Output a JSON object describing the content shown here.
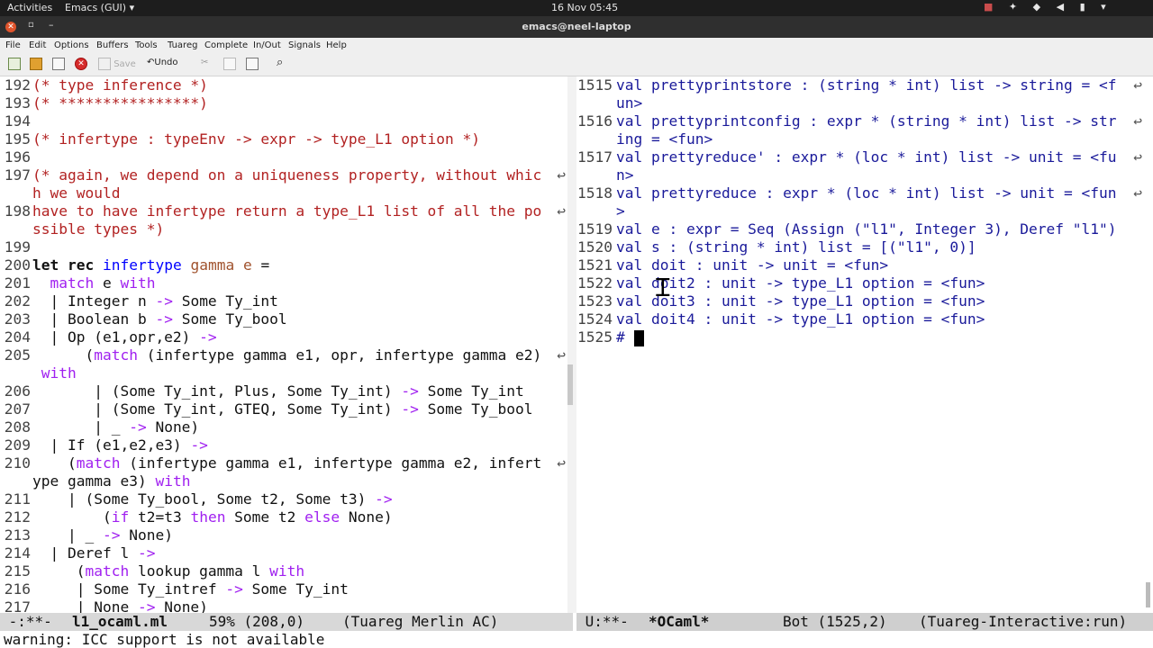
{
  "topbar": {
    "activities": "Activities",
    "app_menu": "Emacs (GUI) ▾",
    "clock": "16 Nov  05:45",
    "tray_icons": [
      "record-icon",
      "accessibility-icon",
      "wifi-icon",
      "volume-icon",
      "battery-icon",
      "menu-arrow-icon"
    ]
  },
  "window": {
    "title": "emacs@neel-laptop"
  },
  "menubar": {
    "items": [
      "File",
      "Edit",
      "Options",
      "Buffers",
      "Tools",
      "Tuareg",
      "Complete",
      "In/Out",
      "Signals",
      "Help"
    ]
  },
  "toolbar": {
    "save_label": "Save",
    "undo_label": "Undo"
  },
  "left_pane": {
    "lines": [
      {
        "n": "192",
        "t": "(* type inference *)"
      },
      {
        "n": "193",
        "t": "(* ****************)"
      },
      {
        "n": "194",
        "t": ""
      },
      {
        "n": "195",
        "t": "(* infertype : typeEnv -> expr -> type_L1 option *)"
      },
      {
        "n": "196",
        "t": ""
      },
      {
        "n": "197",
        "t": "(* again, we depend on a uniqueness property, without whic"
      },
      {
        "n": "",
        "t": "h we would"
      },
      {
        "n": "198",
        "t": "have to have infertype return a type_L1 list of all the po"
      },
      {
        "n": "",
        "t": "ssible types *)"
      },
      {
        "n": "199",
        "t": ""
      },
      {
        "n": "200",
        "t": "let rec infertype gamma e ="
      },
      {
        "n": "201",
        "t": "  match e with"
      },
      {
        "n": "202",
        "t": "  | Integer n -> Some Ty_int"
      },
      {
        "n": "203",
        "t": "  | Boolean b -> Some Ty_bool"
      },
      {
        "n": "204",
        "t": "  | Op (e1,opr,e2) ->"
      },
      {
        "n": "205",
        "t": "      (match (infertype gamma e1, opr, infertype gamma e2)"
      },
      {
        "n": "",
        "t": " with"
      },
      {
        "n": "206",
        "t": "       | (Some Ty_int, Plus, Some Ty_int) -> Some Ty_int"
      },
      {
        "n": "207",
        "t": "       | (Some Ty_int, GTEQ, Some Ty_int) -> Some Ty_bool"
      },
      {
        "n": "208",
        "t": "       | _ -> None)"
      },
      {
        "n": "209",
        "t": "  | If (e1,e2,e3) ->"
      },
      {
        "n": "210",
        "t": "    (match (infertype gamma e1, infertype gamma e2, infert"
      },
      {
        "n": "",
        "t": "ype gamma e3) with"
      },
      {
        "n": "211",
        "t": "    | (Some Ty_bool, Some t2, Some t3) ->"
      },
      {
        "n": "212",
        "t": "        (if t2=t3 then Some t2 else None)"
      },
      {
        "n": "213",
        "t": "    | _ -> None)"
      },
      {
        "n": "214",
        "t": "  | Deref l ->"
      },
      {
        "n": "215",
        "t": "     (match lookup gamma l with"
      },
      {
        "n": "216",
        "t": "     | Some Ty_intref -> Some Ty_int"
      },
      {
        "n": "217",
        "t": "     | None -> None)"
      }
    ]
  },
  "right_pane": {
    "lines": [
      {
        "n": "1515",
        "t": "val prettyprintstore : (string * int) list -> string = <f"
      },
      {
        "n": "",
        "t": "un>"
      },
      {
        "n": "1516",
        "t": "val prettyprintconfig : expr * (string * int) list -> str"
      },
      {
        "n": "",
        "t": "ing = <fun>"
      },
      {
        "n": "1517",
        "t": "val prettyreduce' : expr * (loc * int) list -> unit = <fu"
      },
      {
        "n": "",
        "t": "n>"
      },
      {
        "n": "1518",
        "t": "val prettyreduce : expr * (loc * int) list -> unit = <fun"
      },
      {
        "n": "",
        "t": ">"
      },
      {
        "n": "1519",
        "t": "val e : expr = Seq (Assign (\"l1\", Integer 3), Deref \"l1\")"
      },
      {
        "n": "1520",
        "t": "val s : (string * int) list = [(\"l1\", 0)]"
      },
      {
        "n": "1521",
        "t": "val doit : unit -> unit = <fun>"
      },
      {
        "n": "1522",
        "t": "val doit2 : unit -> type_L1 option = <fun>"
      },
      {
        "n": "1523",
        "t": "val doit3 : unit -> type_L1 option = <fun>"
      },
      {
        "n": "1524",
        "t": "val doit4 : unit -> type_L1 option = <fun>"
      },
      {
        "n": "1525",
        "t": "# "
      }
    ]
  },
  "modeline_left": {
    "state": " -:**-",
    "buffer": "l1_ocaml.ml",
    "position": "59% (208,0)",
    "modes": "(Tuareg Merlin AC)"
  },
  "modeline_right": {
    "state": " U:**-",
    "buffer": "*OCaml*",
    "position": "Bot (1525,2)",
    "modes": "(Tuareg-Interactive:run)"
  },
  "echo_area": "warning: ICC support is not available"
}
